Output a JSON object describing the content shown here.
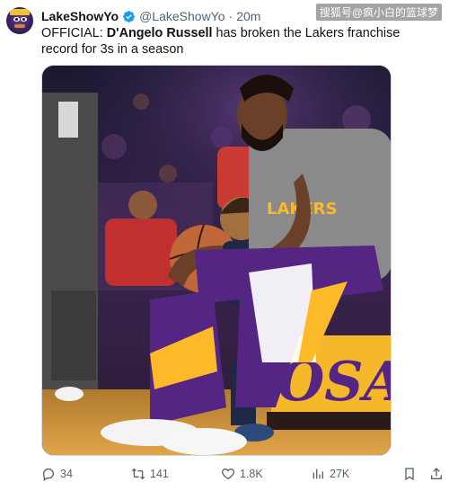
{
  "tweet": {
    "display_name": "LakeShowYo",
    "handle": "@LakeShowYo",
    "separator": "·",
    "time": "20m",
    "text_prefix": "OFFICIAL: ",
    "text_name": "D'Angelo Russell",
    "text_rest": " has broken the Lakers franchise record for 3s in a season"
  },
  "watermark": "搜狐号@疯小白的篮球梦",
  "media": {
    "jersey_lettering": "LAKERS",
    "court_lettering": "OSA"
  },
  "actions": {
    "replies": "34",
    "retweets": "141",
    "likes": "1.8K",
    "views": "27K"
  },
  "colors": {
    "text": "#0f1419",
    "secondary": "#536471",
    "verified": "#1d9bf0",
    "lakers_purple": "#552583",
    "lakers_gold": "#fdb927"
  }
}
